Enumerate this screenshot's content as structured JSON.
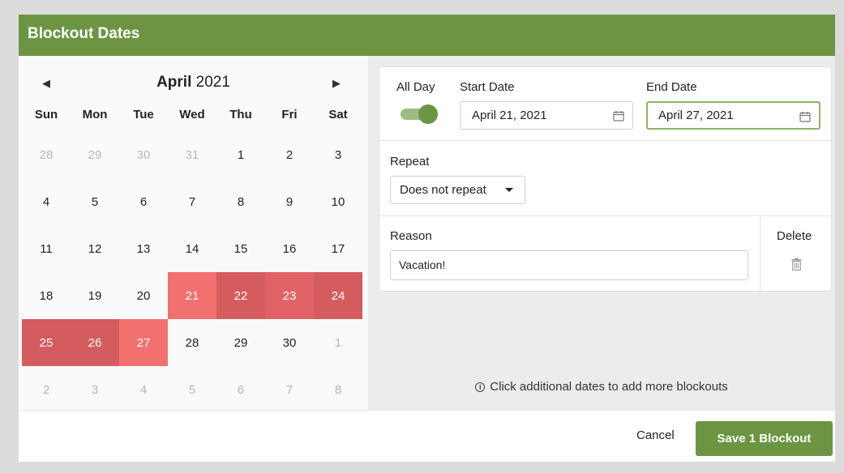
{
  "header": {
    "title": "Blockout Dates"
  },
  "calendar": {
    "month": "April",
    "year": "2021",
    "prev_glyph": "◀",
    "next_glyph": "▶",
    "weekdays": [
      "Sun",
      "Mon",
      "Tue",
      "Wed",
      "Thu",
      "Fri",
      "Sat"
    ],
    "days": [
      {
        "label": "28",
        "state": "muted"
      },
      {
        "label": "29",
        "state": "muted"
      },
      {
        "label": "30",
        "state": "muted"
      },
      {
        "label": "31",
        "state": "muted"
      },
      {
        "label": "1",
        "state": "normal"
      },
      {
        "label": "2",
        "state": "normal"
      },
      {
        "label": "3",
        "state": "normal"
      },
      {
        "label": "4",
        "state": "normal"
      },
      {
        "label": "5",
        "state": "normal"
      },
      {
        "label": "6",
        "state": "normal"
      },
      {
        "label": "7",
        "state": "normal"
      },
      {
        "label": "8",
        "state": "normal"
      },
      {
        "label": "9",
        "state": "normal"
      },
      {
        "label": "10",
        "state": "normal"
      },
      {
        "label": "11",
        "state": "normal"
      },
      {
        "label": "12",
        "state": "normal"
      },
      {
        "label": "13",
        "state": "normal"
      },
      {
        "label": "14",
        "state": "normal"
      },
      {
        "label": "15",
        "state": "normal"
      },
      {
        "label": "16",
        "state": "normal"
      },
      {
        "label": "17",
        "state": "normal"
      },
      {
        "label": "18",
        "state": "normal"
      },
      {
        "label": "19",
        "state": "normal"
      },
      {
        "label": "20",
        "state": "normal"
      },
      {
        "label": "21",
        "state": "range-start"
      },
      {
        "label": "22",
        "state": "range"
      },
      {
        "label": "23",
        "state": "range-mid"
      },
      {
        "label": "24",
        "state": "range"
      },
      {
        "label": "25",
        "state": "range"
      },
      {
        "label": "26",
        "state": "range"
      },
      {
        "label": "27",
        "state": "range-end"
      },
      {
        "label": "28",
        "state": "normal"
      },
      {
        "label": "29",
        "state": "normal"
      },
      {
        "label": "30",
        "state": "normal"
      },
      {
        "label": "1",
        "state": "muted"
      },
      {
        "label": "2",
        "state": "muted"
      },
      {
        "label": "3",
        "state": "muted"
      },
      {
        "label": "4",
        "state": "muted"
      },
      {
        "label": "5",
        "state": "muted"
      },
      {
        "label": "6",
        "state": "muted"
      },
      {
        "label": "7",
        "state": "muted"
      },
      {
        "label": "8",
        "state": "muted"
      }
    ]
  },
  "form": {
    "all_day_label": "All Day",
    "all_day_on": true,
    "start_date_label": "Start Date",
    "start_date_value": "April 21, 2021",
    "end_date_label": "End Date",
    "end_date_value": "April 27, 2021",
    "repeat_label": "Repeat",
    "repeat_value": "Does not repeat",
    "reason_label": "Reason",
    "reason_value": "Vacation!",
    "delete_label": "Delete"
  },
  "hint": {
    "icon": "ⓘ",
    "text": "Click additional dates to add more blockouts"
  },
  "footer": {
    "cancel_label": "Cancel",
    "save_label": "Save 1 Blockout"
  },
  "colors": {
    "accent": "#6b9542",
    "range_light": "#f37070",
    "range_dark": "#d45c5e"
  }
}
